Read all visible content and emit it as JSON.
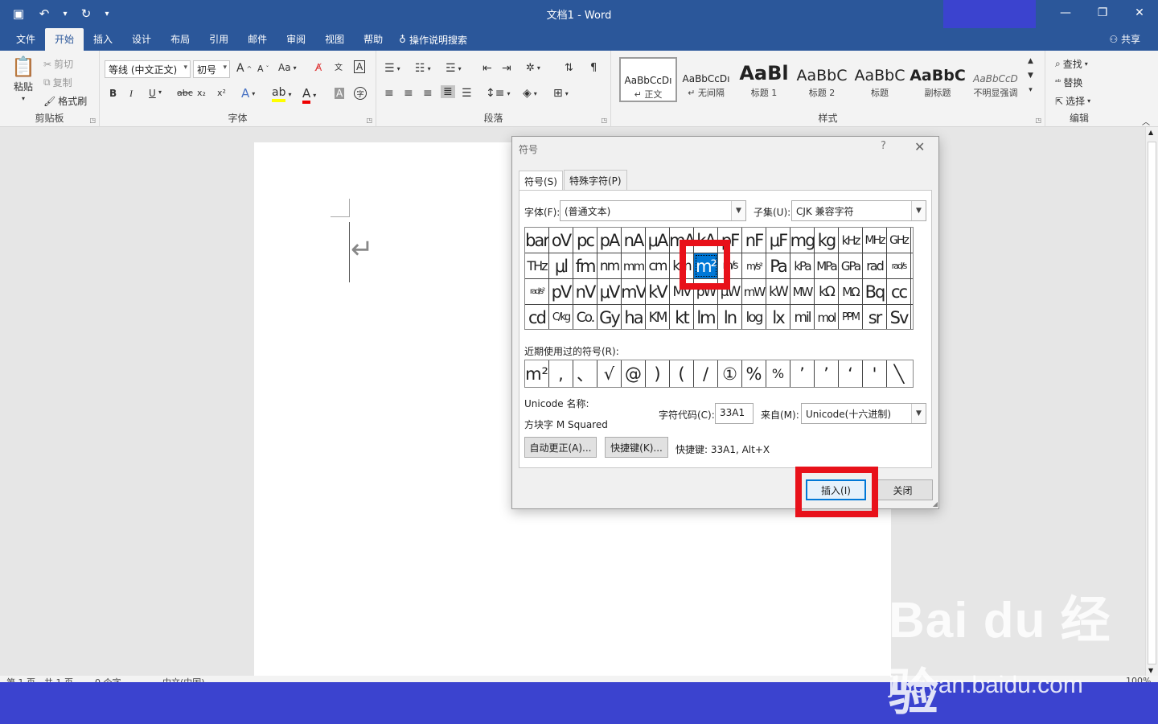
{
  "title": {
    "doc_name": "文档1",
    "sep": "-",
    "app": "Word"
  },
  "qat": {
    "save_icon": "save-icon",
    "undo_icon": "undo-icon",
    "redo_icon": "redo-icon",
    "dropdown": "▾"
  },
  "window_controls": {
    "minimize": "—",
    "restore": "❐",
    "close": "✕"
  },
  "menu": {
    "tabs": [
      "文件",
      "开始",
      "插入",
      "设计",
      "布局",
      "引用",
      "邮件",
      "审阅",
      "视图",
      "帮助"
    ],
    "active": "开始",
    "tell_me": "操作说明搜索",
    "share": "共享"
  },
  "ribbon": {
    "clipboard": {
      "label": "剪贴板",
      "paste": "粘贴",
      "cut": "剪切",
      "copy": "复制",
      "format_painter": "格式刷"
    },
    "font": {
      "label": "字体",
      "font_name": "等线 (中文正文)",
      "font_size": "初号",
      "grow": "A",
      "shrink": "A",
      "case": "Aa",
      "bold": "B",
      "italic": "I",
      "underline": "U",
      "strike": "abc",
      "sub": "x₂",
      "sup": "x²"
    },
    "paragraph": {
      "label": "段落"
    },
    "styles": {
      "label": "样式",
      "items": [
        {
          "preview": "AaBbCcDı",
          "name": "↵ 正文"
        },
        {
          "preview": "AaBbCcDı",
          "name": "↵ 无间隔"
        },
        {
          "preview": "AaBl",
          "name": "标题 1"
        },
        {
          "preview": "AaBbC",
          "name": "标题 2"
        },
        {
          "preview": "AaBbC",
          "name": "标题"
        },
        {
          "preview": "AaBbC",
          "name": "副标题"
        },
        {
          "preview": "AaBbCcD",
          "name": "不明显强调"
        }
      ]
    },
    "editing": {
      "label": "编辑",
      "find": "查找",
      "replace": "替换",
      "select": "选择"
    }
  },
  "dialog": {
    "title": "符号",
    "help": "?",
    "close": "✕",
    "tabs": [
      "符号(S)",
      "特殊字符(P)"
    ],
    "font_label": "字体(F):",
    "font_value": "(普通文本)",
    "subset_label": "子集(U):",
    "subset_value": "CJK 兼容字符",
    "grid": [
      [
        "bar",
        "oV",
        "pc",
        "pA",
        "nA",
        "μA",
        "mA",
        "kA",
        "pF",
        "nF",
        "μF",
        "mg",
        "kg",
        "kHz",
        "MHz",
        "GHz"
      ],
      [
        "THz",
        "μl",
        "fm",
        "nm",
        "mm",
        "cm",
        "km",
        "m²",
        "m/s",
        "m/s²",
        "Pa",
        "kPa",
        "MPa",
        "GPa",
        "rad",
        "rad/s"
      ],
      [
        "rad/s²",
        "pV",
        "nV",
        "μV",
        "mV",
        "kV",
        "MV",
        "pW",
        "μW",
        "mW",
        "kW",
        "MW",
        "kΩ",
        "MΩ",
        "Bq",
        "cc"
      ],
      [
        "cd",
        "C/kg",
        "Co.",
        "Gy",
        "ha",
        "KM",
        "kt",
        "lm",
        "ln",
        "log",
        "lx",
        "mil",
        "mol",
        "PPM",
        "sr",
        "Sv"
      ]
    ],
    "selected": {
      "row": 1,
      "col": 7
    },
    "recent_label": "近期使用过的符号(R):",
    "recent": [
      "m²",
      ",",
      "、",
      "√",
      "@",
      ")",
      "(",
      "/",
      "①",
      "%",
      "%",
      "’",
      "’",
      "‘",
      "'",
      "╲"
    ],
    "unicode_name_label": "Unicode 名称:",
    "unicode_name": "方块字 M Squared",
    "char_code_label": "字符代码(C):",
    "char_code": "33A1",
    "from_label": "来自(M):",
    "from_value": "Unicode(十六进制)",
    "autocorrect": "自动更正(A)...",
    "shortcut_key": "快捷键(K)...",
    "shortcut_text": "快捷键: 33A1, Alt+X",
    "insert": "插入(I)",
    "close_btn": "关闭"
  },
  "status": {
    "page": "第 1 页，共 1 页",
    "words": "0 个字",
    "lang": "中文(中国)",
    "zoom": "100%"
  },
  "watermark": {
    "logo": "Bai du 经验",
    "url": "jingyan.baidu.com"
  }
}
